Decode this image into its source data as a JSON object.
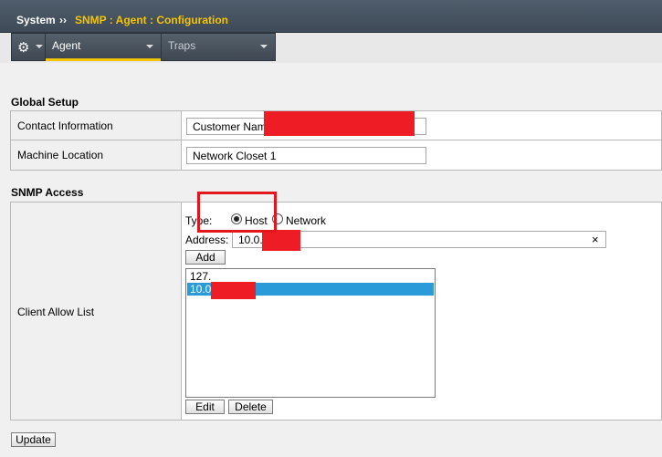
{
  "breadcrumb": {
    "root": "System",
    "separator": "››",
    "current": "SNMP : Agent : Configuration"
  },
  "tabs": [
    {
      "label": "Agent",
      "active": true
    },
    {
      "label": "Traps",
      "active": false
    }
  ],
  "icons": {
    "gear": "gear-icon",
    "dropdown": "chevron-down-icon",
    "clear": "close-icon"
  },
  "global_setup": {
    "title": "Global Setup",
    "contact_label": "Contact Information",
    "contact_value": "Customer Nam",
    "location_label": "Machine Location",
    "location_value": "Network Closet 1"
  },
  "snmp_access": {
    "title": "SNMP Access",
    "row_label": "Client Allow List",
    "type_label": "Type:",
    "type_options": [
      "Host",
      "Network"
    ],
    "type_selected": "Host",
    "address_label": "Address:",
    "address_value": "10.0.",
    "clear_glyph": "×",
    "add_label": "Add",
    "list": [
      {
        "text": "127.",
        "selected": false
      },
      {
        "text": "10.0",
        "selected": true
      }
    ],
    "edit_label": "Edit",
    "delete_label": "Delete"
  },
  "update_label": "Update",
  "colors": {
    "accent": "#f5c400",
    "selection": "#2a9ad8",
    "redaction": "#ee1c25"
  }
}
